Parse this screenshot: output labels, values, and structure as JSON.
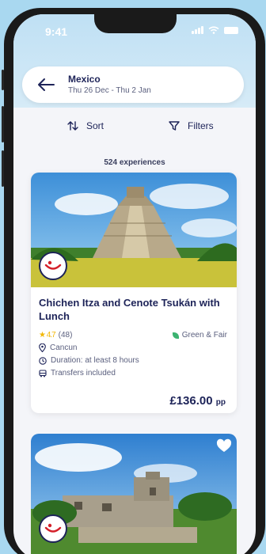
{
  "status_bar": {
    "time": "9:41"
  },
  "search": {
    "destination": "Mexico",
    "dates": "Thu 26 Dec - Thu 2 Jan"
  },
  "toolbar": {
    "sort_label": "Sort",
    "filters_label": "Filters"
  },
  "results": {
    "count_text": "524 experiences"
  },
  "cards": [
    {
      "title": "Chichen Itza and Cenote Tsukán with Lunch",
      "rating_stars": "★ 4.7",
      "rating_count": "(48)",
      "tag": "Green & Fair",
      "location": "Cancun",
      "duration": "Duration: at least 8 hours",
      "transfers": "Transfers included",
      "price": "£136.00",
      "price_unit": "pp"
    }
  ],
  "icons": [
    "back-arrow-icon",
    "sort-icon",
    "filter-icon",
    "star-icon",
    "leaf-icon",
    "location-pin-icon",
    "clock-icon",
    "bus-icon",
    "heart-icon",
    "tui-badge-icon"
  ],
  "colors": {
    "brand_navy": "#1d2358",
    "star": "#f2b705",
    "leaf": "#3cb371",
    "background": "#a9d8f0"
  }
}
